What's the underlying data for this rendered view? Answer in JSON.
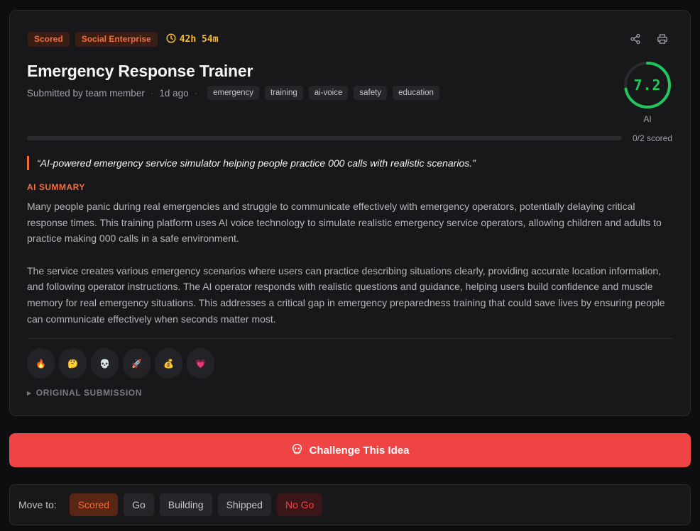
{
  "badges": {
    "status": "Scored",
    "category": "Social Enterprise",
    "timer": "42h 54m"
  },
  "title": "Emergency Response Trainer",
  "meta": {
    "submitted_by": "Submitted by team member",
    "age": "1d ago"
  },
  "tags": [
    "emergency",
    "training",
    "ai-voice",
    "safety",
    "education"
  ],
  "score": {
    "value": "7.2",
    "label": "AI",
    "fraction": 0.72,
    "color": "#22c55e"
  },
  "progress": {
    "text": "0/2 scored",
    "fraction": 0
  },
  "quote": "“AI-powered emergency service simulator helping people practice 000 calls with realistic scenarios.”",
  "summary": {
    "label": "AI SUMMARY",
    "p1": "Many people panic during real emergencies and struggle to communicate effectively with emergency operators, potentially delaying critical response times. This training platform uses AI voice technology to simulate realistic emergency service operators, allowing children and adults to practice making 000 calls in a safe environment.",
    "p2": "The service creates various emergency scenarios where users can practice describing situations clearly, providing accurate location information, and following operator instructions. The AI operator responds with realistic questions and guidance, helping users build confidence and muscle memory for real emergency situations. This addresses a critical gap in emergency preparedness training that could save lives by ensuring people can communicate effectively when seconds matter most."
  },
  "reactions": [
    "🔥",
    "🤔",
    "💀",
    "🚀",
    "💰",
    "💗"
  ],
  "original_submission": "ORIGINAL SUBMISSION",
  "challenge": {
    "label": "Challenge This Idea"
  },
  "move": {
    "label": "Move to:",
    "options": [
      "Scored",
      "Go",
      "Building",
      "Shipped",
      "No Go"
    ]
  },
  "colors": {
    "accent": "#f26c3a",
    "success": "#22c55e",
    "danger": "#ef4444",
    "timer": "#f5b82e"
  }
}
